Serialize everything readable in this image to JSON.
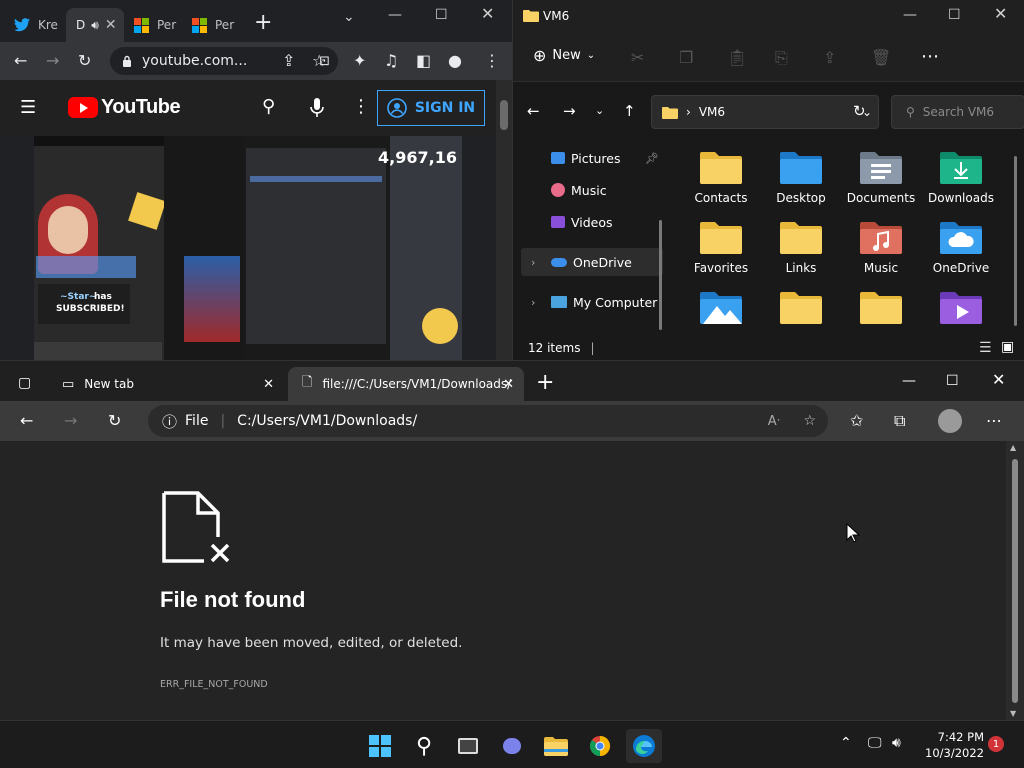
{
  "chrome": {
    "tabs": [
      {
        "label": "Kre",
        "icon": "twitter-icon"
      },
      {
        "label": "D",
        "icon": "audio-icon"
      },
      {
        "label": "Per",
        "icon": "windows-logo-icon"
      },
      {
        "label": "Per",
        "icon": "windows-logo-icon"
      }
    ],
    "url": "youtube.com...",
    "youtube": {
      "logo_text": "YouTube",
      "signin_label": "SIGN IN",
      "video_counter": "4,967,16",
      "overlay_star": "~Star~",
      "overlay_has": "has",
      "overlay_subscribed": "SUBSCRIBED!"
    }
  },
  "explorer": {
    "title": "VM6",
    "new_label": "New",
    "breadcrumb": "VM6",
    "search_placeholder": "Search VM6",
    "sidebar": [
      {
        "label": "Pictures",
        "icon": "pictures-icon",
        "pinned": true
      },
      {
        "label": "Music",
        "icon": "music-icon"
      },
      {
        "label": "Videos",
        "icon": "videos-icon"
      },
      {
        "label": "OneDrive",
        "icon": "onedrive-icon",
        "selected": true
      },
      {
        "label": "My Computer",
        "icon": "computer-icon"
      }
    ],
    "items": [
      {
        "label": "Contacts",
        "icon": "folder-icon"
      },
      {
        "label": "Desktop",
        "icon": "desktop-folder-icon"
      },
      {
        "label": "Documents",
        "icon": "documents-folder-icon"
      },
      {
        "label": "Downloads",
        "icon": "downloads-folder-icon"
      },
      {
        "label": "Favorites",
        "icon": "folder-icon"
      },
      {
        "label": "Links",
        "icon": "folder-icon"
      },
      {
        "label": "Music",
        "icon": "music-folder-icon"
      },
      {
        "label": "OneDrive",
        "icon": "onedrive-folder-icon"
      },
      {
        "label": "",
        "icon": "pictures-folder-icon"
      },
      {
        "label": "",
        "icon": "folder-icon"
      },
      {
        "label": "",
        "icon": "folder-icon"
      },
      {
        "label": "",
        "icon": "videos-folder-icon"
      }
    ],
    "status": "12 items"
  },
  "edge": {
    "tabs": [
      {
        "label": "New tab"
      },
      {
        "label": "file:///C:/Users/VM1/Downloads/"
      }
    ],
    "address_scheme": "File",
    "address_url": "C:/Users/VM1/Downloads/",
    "error_title": "File not found",
    "error_message": "It may have been moved, edited, or deleted.",
    "error_code": "ERR_FILE_NOT_FOUND"
  },
  "taskbar": {
    "time": "7:42 PM",
    "date": "10/3/2022",
    "notification_count": "1"
  },
  "colors": {
    "chrome_bg": "#202124",
    "youtube_red": "#ff0000",
    "signin_blue": "#3ea6ff",
    "folder_yellow": "#f8d264",
    "edge_bg": "#242424"
  }
}
